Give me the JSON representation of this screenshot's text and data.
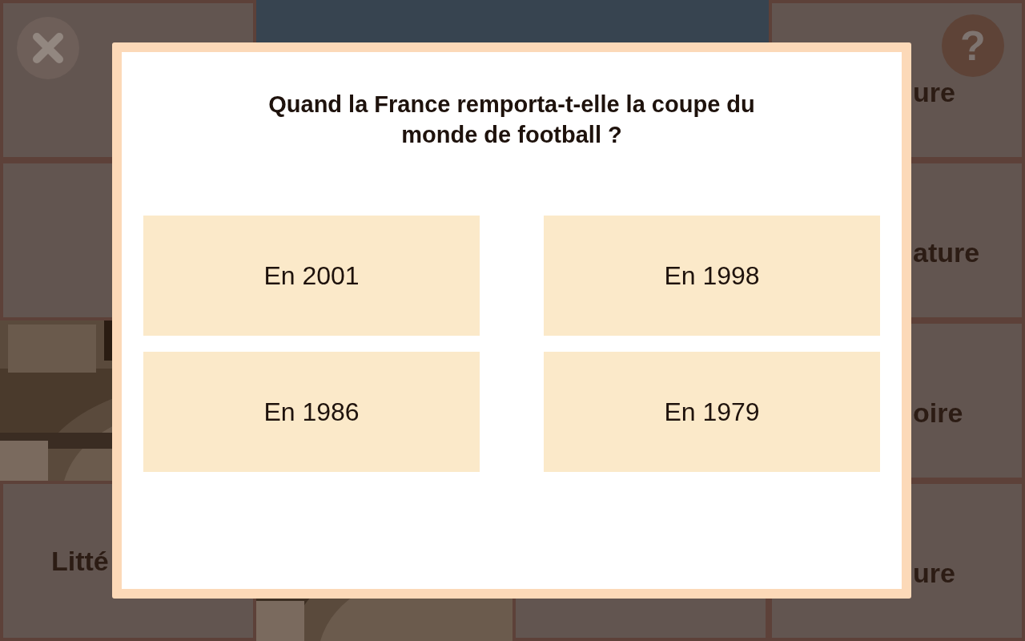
{
  "tiles": [
    {
      "kind": "blank"
    },
    {
      "kind": "dark"
    },
    {
      "kind": "dark"
    },
    {
      "kind": "text",
      "label": "ure"
    },
    {
      "kind": "blank"
    },
    {
      "kind": "hidden"
    },
    {
      "kind": "hidden"
    },
    {
      "kind": "text",
      "label": "ature"
    },
    {
      "kind": "picture"
    },
    {
      "kind": "hidden"
    },
    {
      "kind": "hidden"
    },
    {
      "kind": "text",
      "label": "oire"
    },
    {
      "kind": "text",
      "label": "Litté"
    },
    {
      "kind": "picture"
    },
    {
      "kind": "blank"
    },
    {
      "kind": "text",
      "label": "ure"
    }
  ],
  "help_button": {
    "label": "?"
  },
  "quiz": {
    "question": "Quand la France remporta-t-elle la coupe du monde de football ?",
    "answers": [
      {
        "label": "En 2001"
      },
      {
        "label": "En 1998"
      },
      {
        "label": "En 1986"
      },
      {
        "label": "En 1979"
      }
    ]
  }
}
